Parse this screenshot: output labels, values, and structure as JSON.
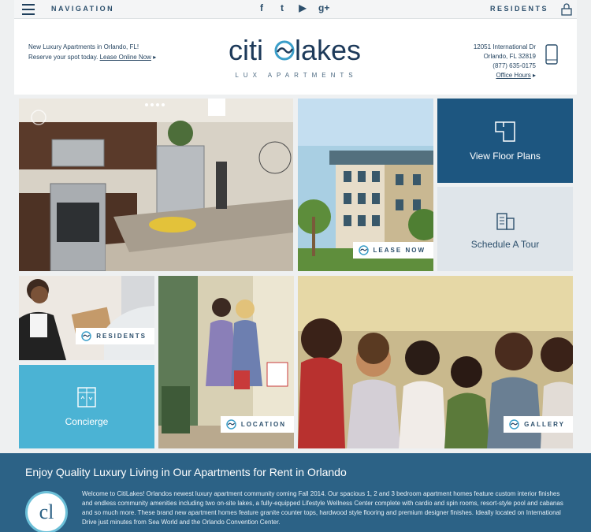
{
  "topbar": {
    "navigation_label": "NAVIGATION",
    "residents_label": "RESIDENTS",
    "social": [
      {
        "name": "facebook-icon",
        "glyph": "f"
      },
      {
        "name": "twitter-icon",
        "glyph": "t"
      },
      {
        "name": "youtube-icon",
        "glyph": "▶"
      },
      {
        "name": "google-plus-icon",
        "glyph": "g+"
      }
    ]
  },
  "header": {
    "promo_line1": "New Luxury Apartments in Orlando, FL!",
    "promo_line2": "Reserve your spot today.",
    "promo_link": "Lease Online Now",
    "logo_wordmark": "citi lakes",
    "logo_sub": "LUX APARTMENTS",
    "address_line1": "12051 International Dr",
    "address_line2": "Orlando, FL 32819",
    "phone": "(877) 635-0175",
    "office_hours_link": "Office Hours"
  },
  "tiles": {
    "lease_now": "LEASE NOW",
    "floor_plans": "View Floor Plans",
    "schedule_tour": "Schedule A Tour",
    "residents": "RESIDENTS",
    "concierge": "Concierge",
    "location": "LOCATION",
    "gallery": "GALLERY"
  },
  "colors": {
    "navy": "#1d5680",
    "light_tile": "#dfe5ea",
    "teal": "#4bb3d4",
    "brand": "#1d3a5a"
  },
  "welcome": {
    "title": "Enjoy Quality Luxury Living in Our Apartments for Rent in Orlando",
    "badge": "cl",
    "paragraph": "Welcome to CitiLakes! Orlandos newest luxury apartment community coming Fall 2014. Our spacious 1, 2 and 3 bedroom apartment homes feature custom interior finishes and endless community amenities including two on-site lakes, a fully-equipped Lifestyle Wellness Center complete with cardio and spin rooms, resort-style pool and cabanas and so much more. These brand new apartment homes feature granite counter tops, hardwood style flooring and premium designer finishes. Ideally located on International Drive just minutes from Sea World and the Orlando Convention Center."
  }
}
